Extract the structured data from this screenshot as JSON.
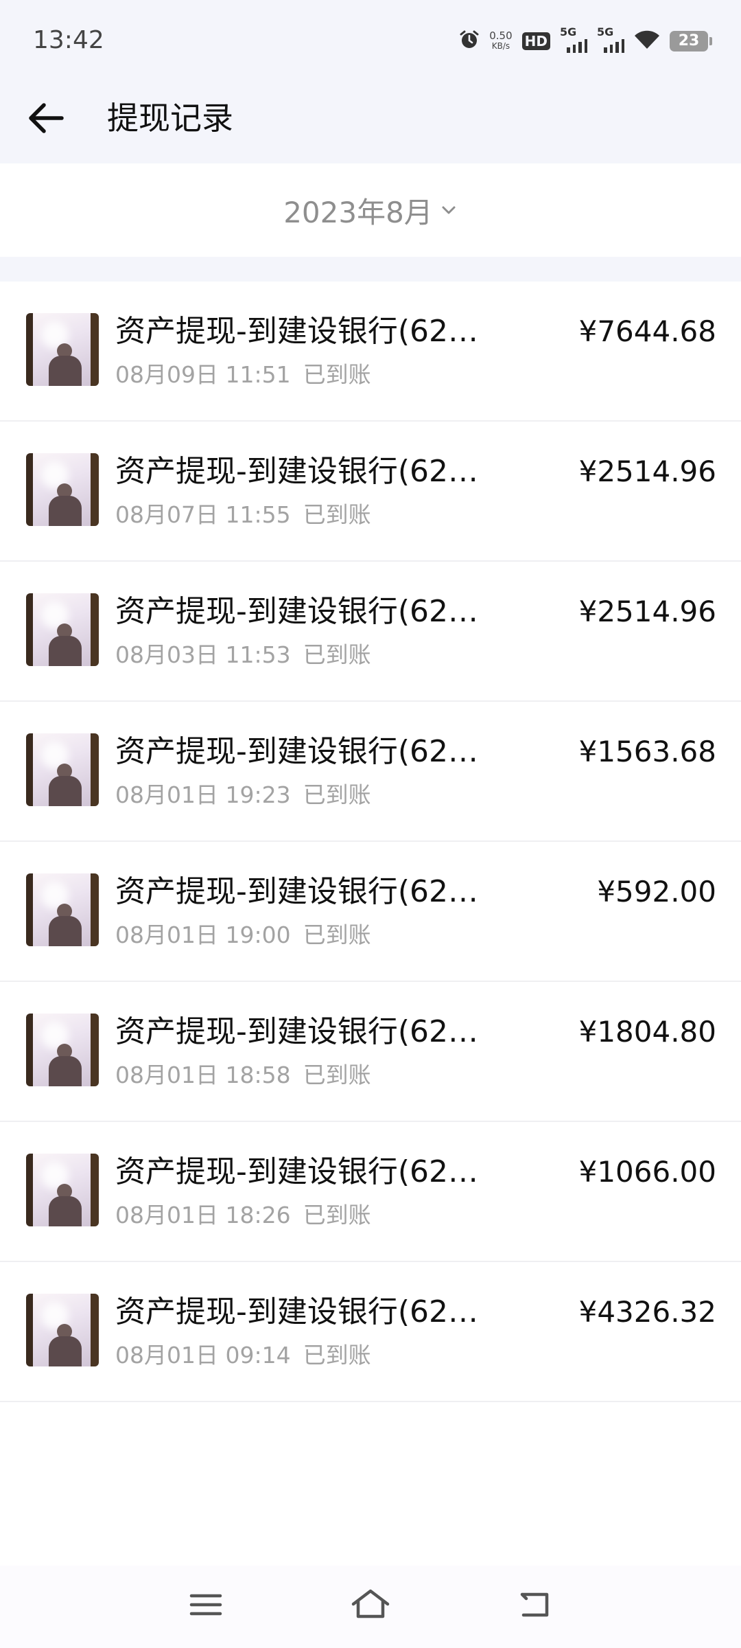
{
  "status_bar": {
    "time": "13:42",
    "net_speed_value": "0.50",
    "net_speed_unit": "KB/s",
    "hd_label": "HD",
    "sim1_label": "5G",
    "sim2_label": "5G",
    "battery_level": "23"
  },
  "header": {
    "title": "提现记录"
  },
  "month_selector": {
    "value": "2023年8月"
  },
  "records": [
    {
      "title": "资产提现-到建设银行(62…",
      "date": "08月09日 11:51",
      "status": "已到账",
      "amount": "¥7644.68"
    },
    {
      "title": "资产提现-到建设银行(62…",
      "date": "08月07日 11:55",
      "status": "已到账",
      "amount": "¥2514.96"
    },
    {
      "title": "资产提现-到建设银行(62…",
      "date": "08月03日 11:53",
      "status": "已到账",
      "amount": "¥2514.96"
    },
    {
      "title": "资产提现-到建设银行(62…",
      "date": "08月01日 19:23",
      "status": "已到账",
      "amount": "¥1563.68"
    },
    {
      "title": "资产提现-到建设银行(62…",
      "date": "08月01日 19:00",
      "status": "已到账",
      "amount": "¥592.00"
    },
    {
      "title": "资产提现-到建设银行(62…",
      "date": "08月01日 18:58",
      "status": "已到账",
      "amount": "¥1804.80"
    },
    {
      "title": "资产提现-到建设银行(62…",
      "date": "08月01日 18:26",
      "status": "已到账",
      "amount": "¥1066.00"
    },
    {
      "title": "资产提现-到建设银行(62…",
      "date": "08月01日 09:14",
      "status": "已到账",
      "amount": "¥4326.32"
    }
  ],
  "icons": {
    "back": "arrow-left-icon",
    "month_dropdown": "chevron-down-icon",
    "alarm": "alarm-icon",
    "wifi": "wifi-icon",
    "battery": "battery-icon",
    "nav_menu": "menu-icon",
    "nav_home": "home-icon",
    "nav_back": "back-icon"
  },
  "colors": {
    "header_bg": "#f4f5fb",
    "secondary_text": "#a3a3a3"
  }
}
